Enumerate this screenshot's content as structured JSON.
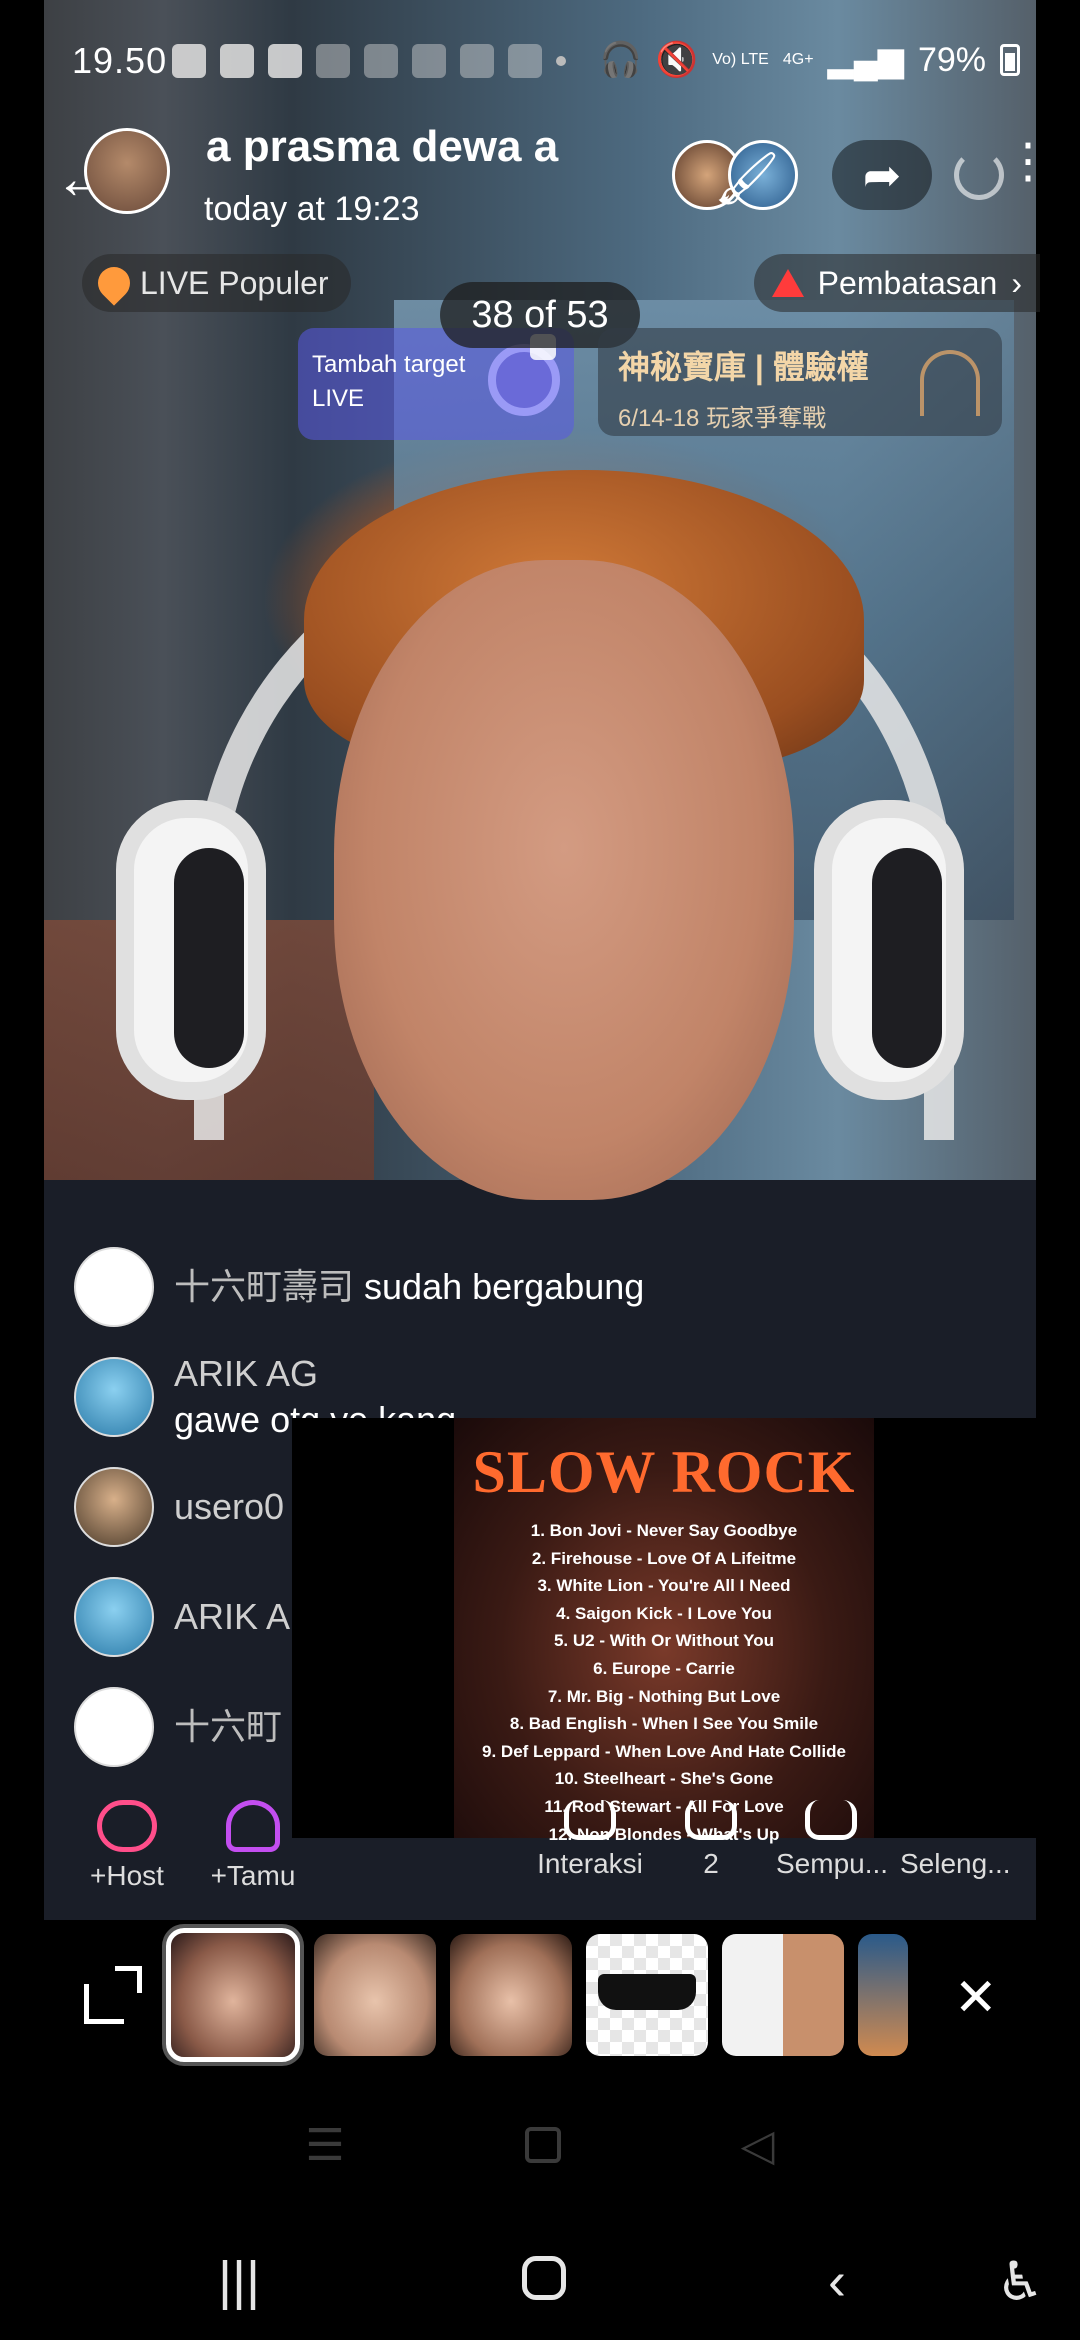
{
  "status_bar": {
    "time": "19.50",
    "network_a": "Vo) LTE",
    "network_b": "4G+",
    "battery": "79%"
  },
  "header": {
    "title": "a prasma dewa   a",
    "subtitle": "today at 19:23"
  },
  "badges": {
    "live_popular": "LIVE Populer",
    "restriction": "Pembatasan"
  },
  "counter": "38 of 53",
  "target_card": {
    "line1": "Tambah target",
    "line2": "LIVE"
  },
  "event_card": {
    "title": "神秘寶庫 | 體驗權",
    "subtitle": "6/14-18 玩家爭奪戰"
  },
  "chat": [
    {
      "name": "十六町壽司",
      "message": "sudah bergabung"
    },
    {
      "name": "ARIK AG",
      "message": "gawe otg ye kang"
    },
    {
      "name": "usero0",
      "message": ""
    },
    {
      "name": "ARIK A",
      "message": ""
    },
    {
      "name": "十六町",
      "message": ""
    }
  ],
  "album": {
    "title": "SLOW ROCK",
    "tracks": [
      "1. Bon Jovi - Never Say Goodbye",
      "2. Firehouse - Love Of A Lifeitme",
      "3. White Lion - You're All I Need",
      "4. Saigon Kick - I Love You",
      "5. U2 - With Or Without You",
      "6. Europe - Carrie",
      "7. Mr. Big - Nothing But Love",
      "8. Bad English - When I See You Smile",
      "9. Def Leppard - When Love And Hate Collide",
      "10. Steelheart - She's Gone",
      "11. Rod Stewart - All For Love",
      "12. Non Blondes - What's Up"
    ]
  },
  "actions": {
    "host": "+Host",
    "guest": "+Tamu",
    "interaction": "Interaksi",
    "count": "2",
    "perfect": "Sempu...",
    "more": "Seleng..."
  },
  "icons": {
    "back": "arrow-left-icon",
    "share": "share-arrow-icon",
    "power": "power-icon",
    "more": "more-vertical-icon",
    "expand": "expand-icon",
    "close": "close-icon"
  },
  "colors": {
    "accent_pink": "#ff4e8a",
    "accent_orange": "#ff6a2e",
    "warning_red": "#ff3b3b"
  }
}
